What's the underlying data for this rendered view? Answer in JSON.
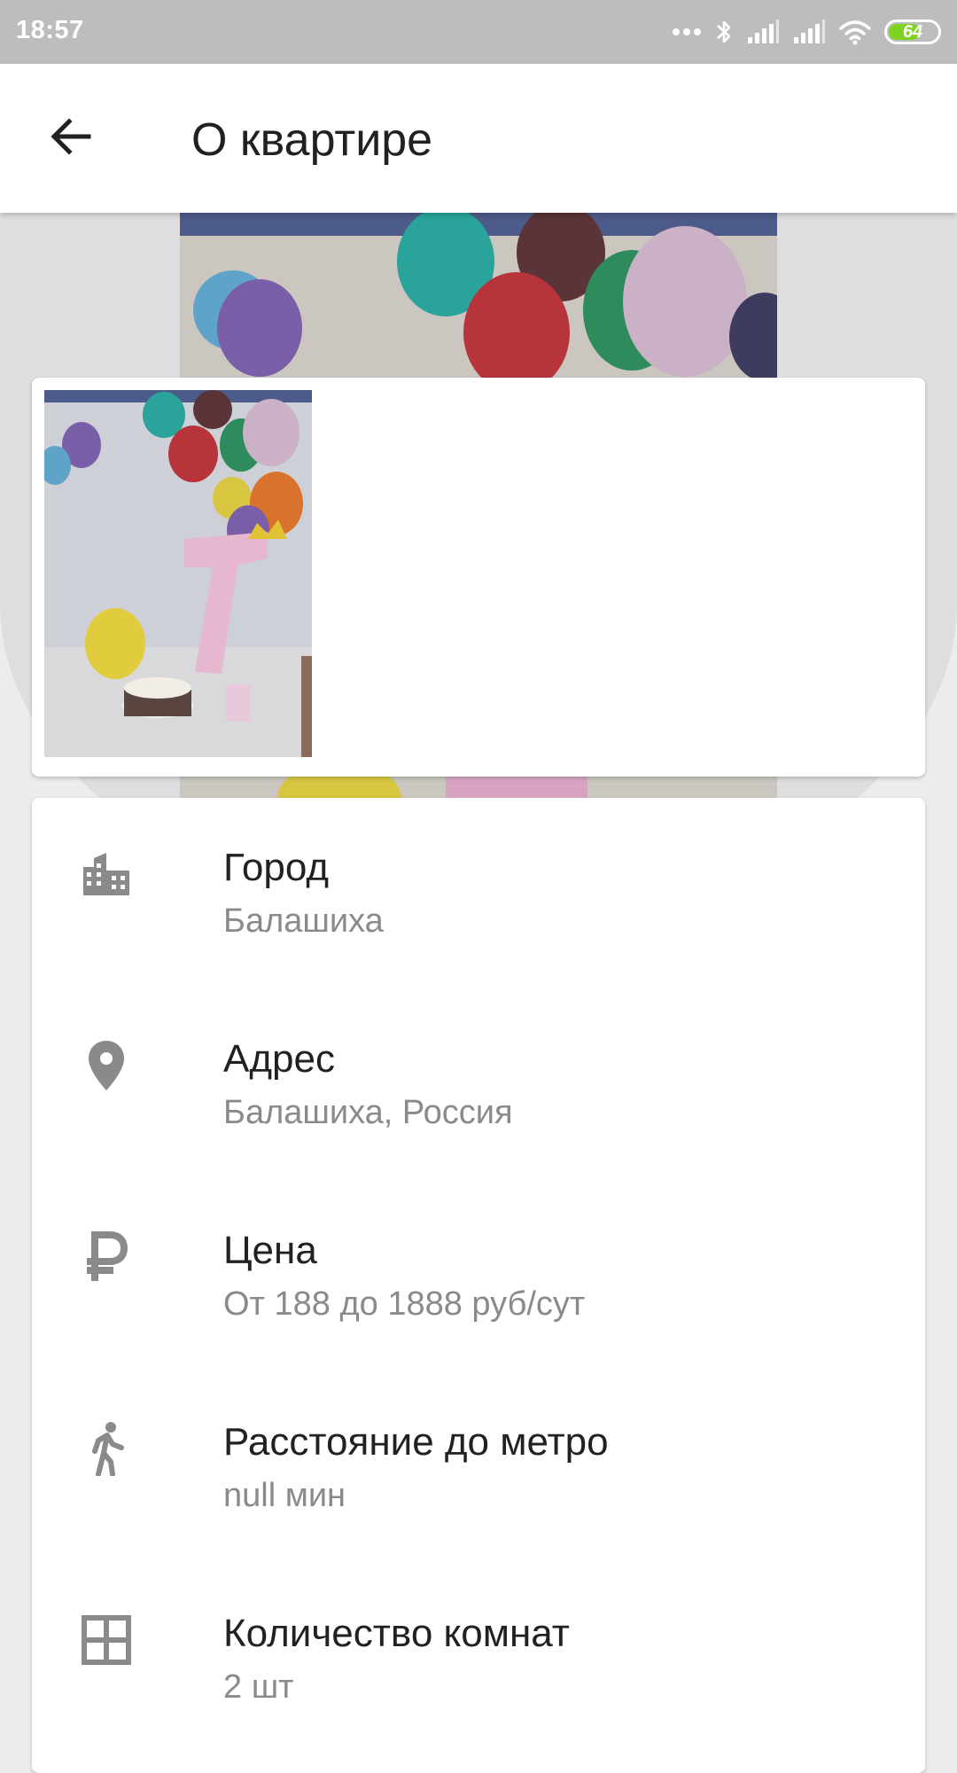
{
  "status_bar": {
    "time": "18:57",
    "battery_level": "64",
    "battery_fraction": 0.64,
    "battery_color": "#7ed321",
    "icons": [
      "more-dots-icon",
      "bluetooth-icon",
      "signal-icon",
      "signal-icon",
      "wifi-icon",
      "battery-icon"
    ]
  },
  "app_bar": {
    "back_icon": "arrow-back-icon",
    "title": "О квартире"
  },
  "gallery": {
    "thumbnail_count": 1
  },
  "info": {
    "items": [
      {
        "icon": "city-icon",
        "title": "Город",
        "value": "Балашиха"
      },
      {
        "icon": "location-pin-icon",
        "title": "Адрес",
        "value": "Балашиха, Россия"
      },
      {
        "icon": "ruble-icon",
        "title": "Цена",
        "value": "От 188 до 1888 руб/сут"
      },
      {
        "icon": "walking-icon",
        "title": "Расстояние до метро",
        "value": "null мин"
      },
      {
        "icon": "rooms-grid-icon",
        "title": "Количество комнат",
        "value": "2 шт"
      }
    ]
  },
  "colors": {
    "status_bar_bg": "#bdbdbd",
    "icon_gray": "#8a8a8a",
    "text_primary": "#212121",
    "text_secondary": "#8a8a8a"
  }
}
